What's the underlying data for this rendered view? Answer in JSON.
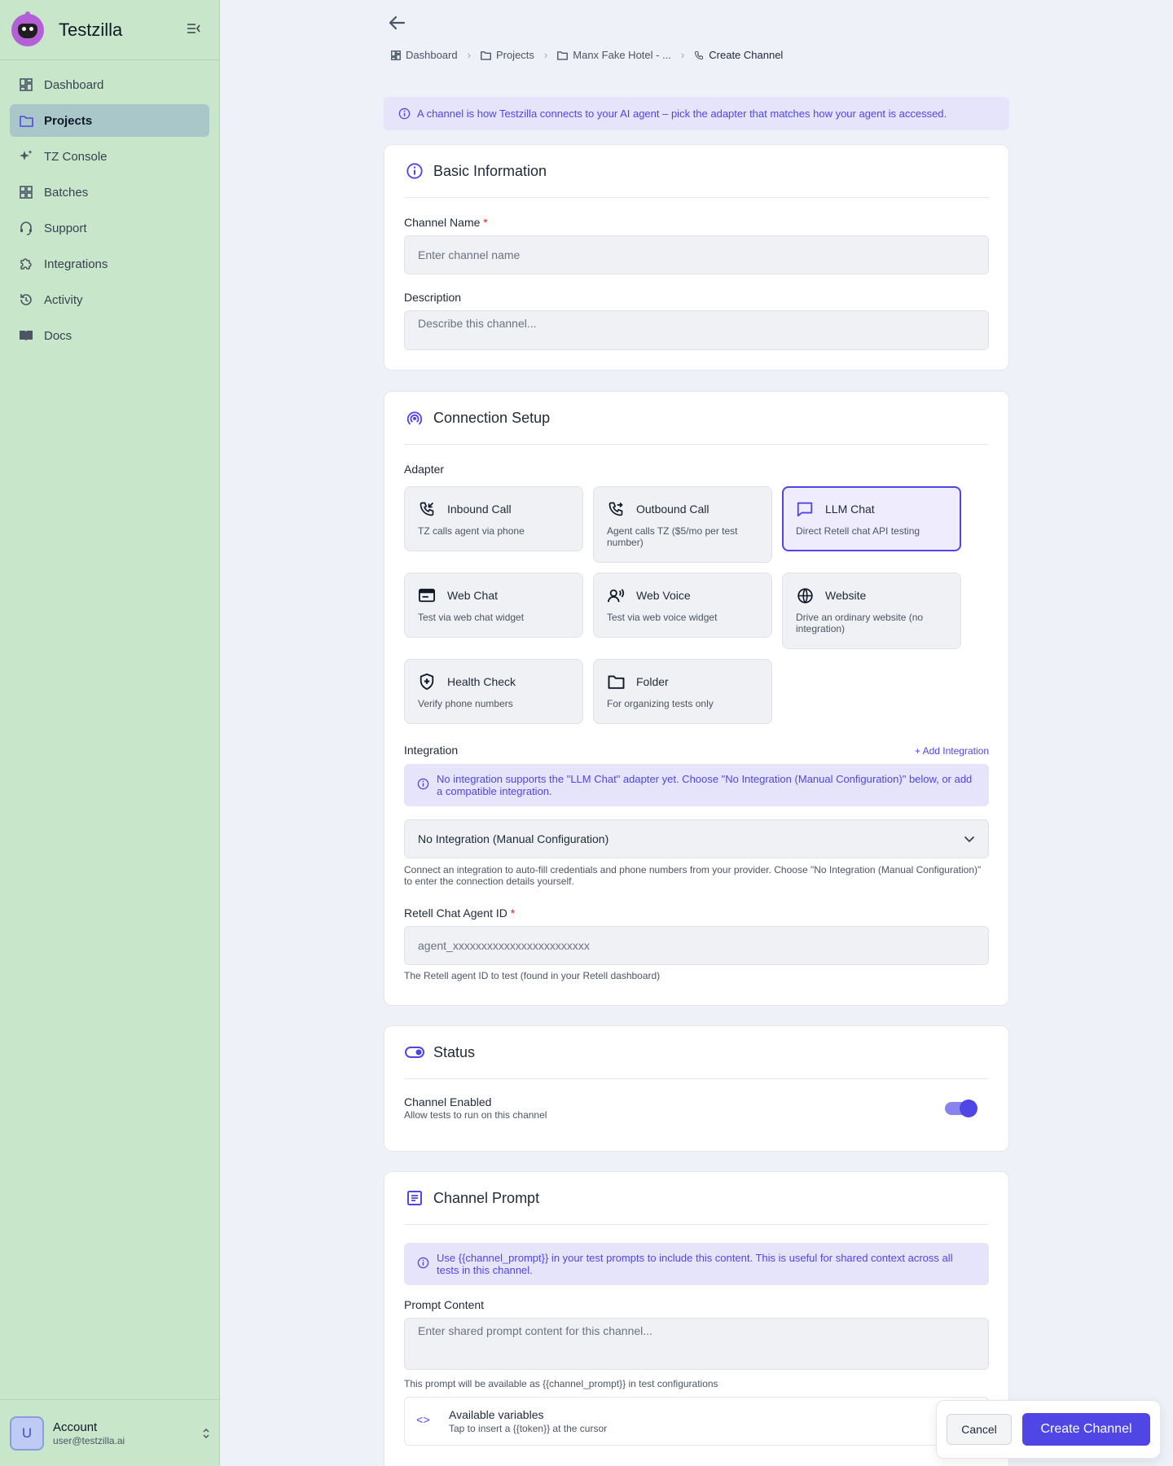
{
  "app": {
    "name": "Testzilla"
  },
  "sidebar": {
    "items": [
      {
        "label": "Dashboard",
        "icon": "dashboard-icon",
        "active": false
      },
      {
        "label": "Projects",
        "icon": "folder-icon",
        "active": true
      },
      {
        "label": "TZ Console",
        "icon": "sparkle-icon",
        "active": false
      },
      {
        "label": "Batches",
        "icon": "grid-icon",
        "active": false
      },
      {
        "label": "Support",
        "icon": "headset-icon",
        "active": false
      },
      {
        "label": "Integrations",
        "icon": "puzzle-icon",
        "active": false
      },
      {
        "label": "Activity",
        "icon": "history-icon",
        "active": false
      },
      {
        "label": "Docs",
        "icon": "book-icon",
        "active": false
      }
    ]
  },
  "account": {
    "initial": "U",
    "name": "Account",
    "email": "user@testzilla.ai"
  },
  "breadcrumb": [
    {
      "label": "Dashboard",
      "icon": "dashboard-icon"
    },
    {
      "label": "Projects",
      "icon": "folder-icon"
    },
    {
      "label": "Manx Fake Hotel - ...",
      "icon": "folder-icon"
    },
    {
      "label": "Create Channel",
      "icon": "phone-icon"
    }
  ],
  "banner": {
    "text": "A channel is how Testzilla connects to your AI agent – pick the adapter that matches how your agent is accessed."
  },
  "basic": {
    "title": "Basic Information",
    "name_label": "Channel Name",
    "required_mark": "*",
    "name_placeholder": "Enter channel name",
    "desc_label": "Description",
    "desc_placeholder": "Describe this channel..."
  },
  "connection": {
    "title": "Connection Setup",
    "adapter_label": "Adapter",
    "adapters": [
      {
        "name": "Inbound Call",
        "desc": "TZ calls agent via phone",
        "icon": "phone-incoming-icon",
        "selected": false
      },
      {
        "name": "Outbound Call",
        "desc": "Agent calls TZ ($5/mo per test number)",
        "icon": "phone-outgoing-icon",
        "selected": false
      },
      {
        "name": "LLM Chat",
        "desc": "Direct Retell chat API testing",
        "icon": "chat-bubble-icon",
        "selected": true
      },
      {
        "name": "Web Chat",
        "desc": "Test via web chat widget",
        "icon": "browser-window-icon",
        "selected": false
      },
      {
        "name": "Web Voice",
        "desc": "Test via web voice widget",
        "icon": "voice-user-icon",
        "selected": false
      },
      {
        "name": "Website",
        "desc": "Drive an ordinary website (no integration)",
        "icon": "globe-icon",
        "selected": false
      },
      {
        "name": "Health Check",
        "desc": "Verify phone numbers",
        "icon": "shield-plus-icon",
        "selected": false
      },
      {
        "name": "Folder",
        "desc": "For organizing tests only",
        "icon": "folder-icon",
        "selected": false
      }
    ],
    "integration_label": "Integration",
    "add_integration": "+ Add Integration",
    "integration_note": "No integration supports the \"LLM Chat\" adapter yet. Choose \"No Integration (Manual Configuration)\" below, or add a compatible integration.",
    "integration_value": "No Integration (Manual Configuration)",
    "integration_help": "Connect an integration to auto-fill credentials and phone numbers from your provider. Choose \"No Integration (Manual Configuration)\" to enter the connection details yourself.",
    "agent_label": "Retell Chat Agent ID",
    "agent_placeholder": "agent_xxxxxxxxxxxxxxxxxxxxxxxx",
    "agent_help": "The Retell agent ID to test (found in your Retell dashboard)"
  },
  "status": {
    "title": "Status",
    "enabled_label": "Channel Enabled",
    "enabled_help": "Allow tests to run on this channel",
    "enabled": true
  },
  "prompt": {
    "title": "Channel Prompt",
    "note": "Use {{channel_prompt}} in your test prompts to include this content. This is useful for shared context across all tests in this channel.",
    "content_label": "Prompt Content",
    "content_placeholder": "Enter shared prompt content for this channel...",
    "content_help": "This prompt will be available as {{channel_prompt}} in test configurations",
    "vars_code": "<>",
    "vars_title": "Available variables",
    "vars_help": "Tap to insert a {{token}} at the cursor"
  },
  "actions": {
    "cancel": "Cancel",
    "create": "Create Channel"
  },
  "colors": {
    "accent": "#4f46e5",
    "sidebar_bg": "#c8e6c9",
    "page_bg": "#eef1f7",
    "required": "#dc2626"
  }
}
